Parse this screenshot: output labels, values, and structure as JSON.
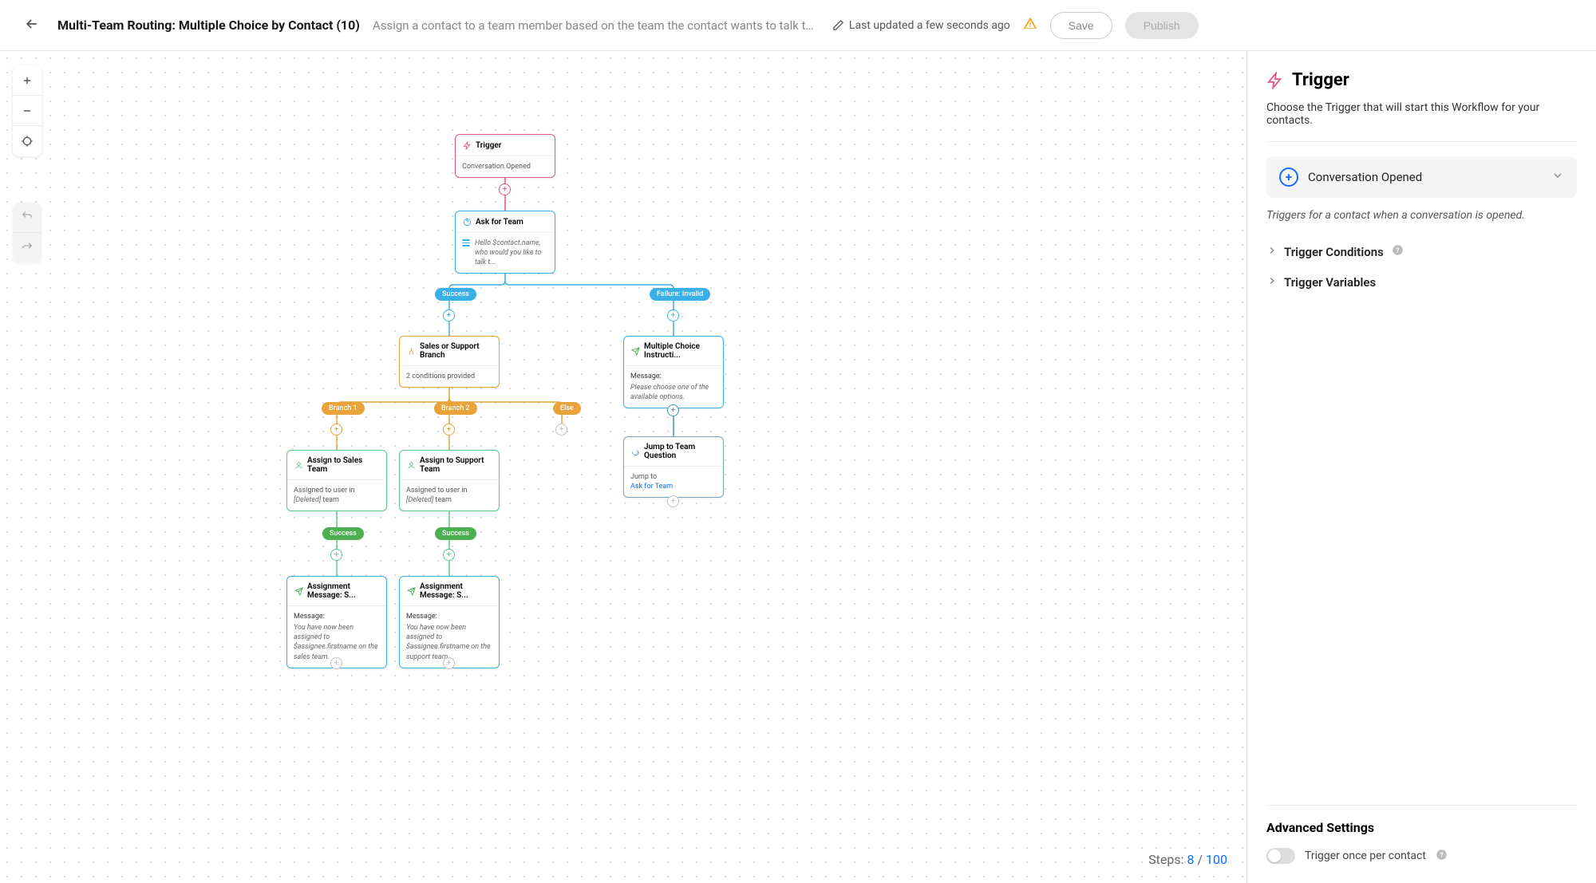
{
  "header": {
    "title": "Multi-Team Routing: Multiple Choice by Contact (10)",
    "description": "Assign a contact to a team member based on the team the contact wants to talk to every time …",
    "last_updated": "Last updated a few seconds ago",
    "save": "Save",
    "publish": "Publish"
  },
  "canvas": {
    "steps_label": "Steps:",
    "steps_current": "8",
    "steps_sep": "/",
    "steps_max": "100",
    "nodes": {
      "trigger": {
        "label": "Trigger",
        "body": "Conversation Opened"
      },
      "ask": {
        "label": "Ask for Team",
        "body": "Hello $contact.name, who would you like to talk t..."
      },
      "branch": {
        "label": "Sales or Support Branch",
        "body": "2 conditions provided"
      },
      "mc": {
        "label": "Multiple Choice Instructi...",
        "msg_label": "Message:",
        "msg": "Please choose one of the available options."
      },
      "assign_sales": {
        "label": "Assign to Sales Team",
        "body_prefix": "Assigned to user in ",
        "body_deleted": "[Deleted]",
        "body_suffix": " team"
      },
      "assign_support": {
        "label": "Assign to Support Team",
        "body_prefix": "Assigned to user in ",
        "body_deleted": "[Deleted]",
        "body_suffix": " team"
      },
      "jump": {
        "label": "Jump to Team Question",
        "body_label": "Jump to",
        "body_target": "Ask for Team"
      },
      "msg_sales": {
        "label": "Assignment Message: S...",
        "msg_label": "Message:",
        "msg": "You have now been assigned to $assignee.firstname on the sales team."
      },
      "msg_support": {
        "label": "Assignment Message: S...",
        "msg_label": "Message:",
        "msg": "You have now been assigned to $assignee.firstname on the support team."
      }
    },
    "pills": {
      "success": "Success",
      "failure": "Failure: Invalid",
      "branch1": "Branch 1",
      "branch2": "Branch 2",
      "else": "Else",
      "ok1": "Success",
      "ok2": "Success"
    }
  },
  "sidebar": {
    "title": "Trigger",
    "desc": "Choose the Trigger that will start this Workflow for your contacts.",
    "select_label": "Conversation Opened",
    "select_desc": "Triggers for a contact when a conversation is opened.",
    "conditions": "Trigger Conditions",
    "variables": "Trigger Variables",
    "advanced": "Advanced Settings",
    "toggle_label": "Trigger once per contact"
  }
}
